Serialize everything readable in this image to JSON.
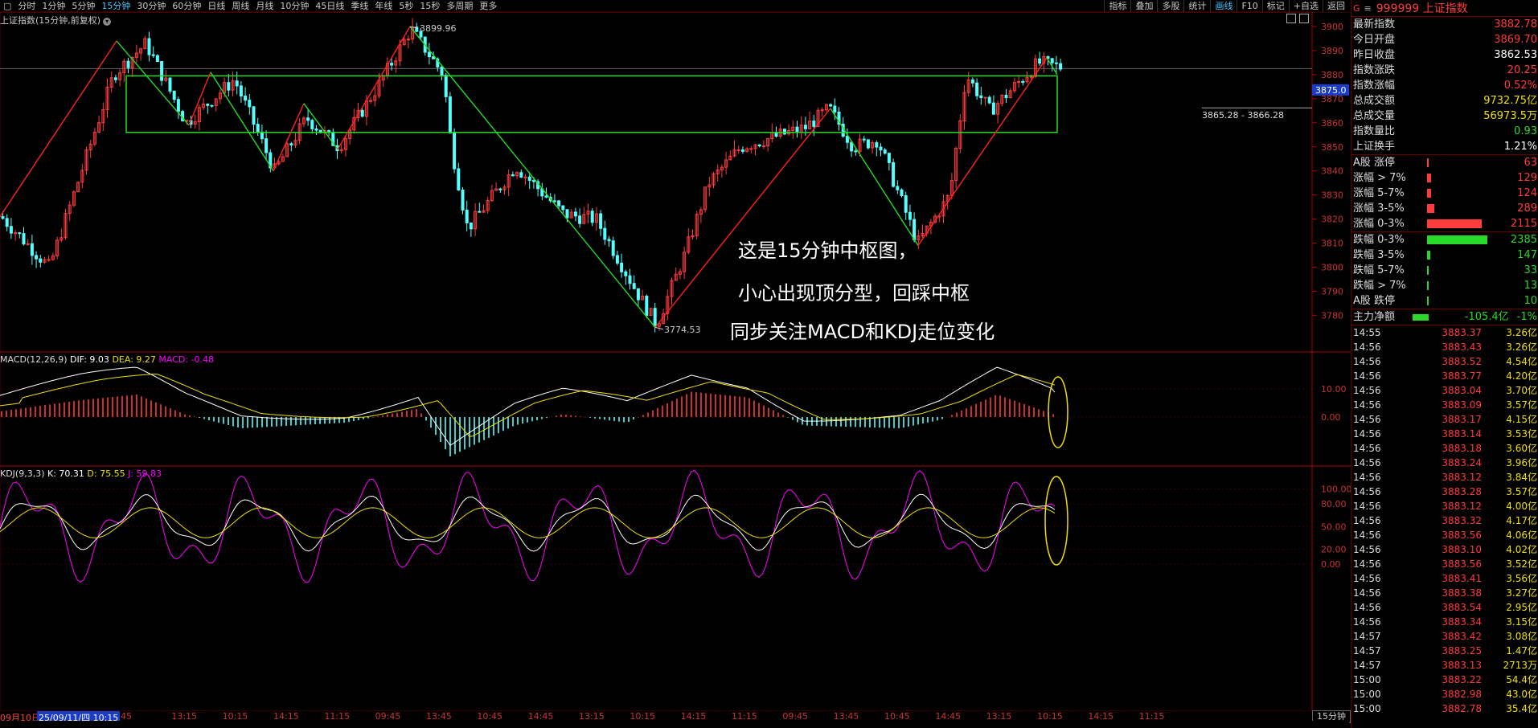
{
  "toolbar": {
    "periods": [
      "分时",
      "1分钟",
      "5分钟",
      "15分钟",
      "30分钟",
      "60分钟",
      "日线",
      "周线",
      "月线",
      "10分钟",
      "45日线",
      "季线",
      "年线",
      "5秒",
      "15秒",
      "多周期",
      "更多"
    ],
    "active_period": "15分钟",
    "right_tools": [
      "指标",
      "叠加",
      "多股",
      "统计",
      "画线",
      "F10",
      "标记",
      "+自选",
      "返回"
    ]
  },
  "chart": {
    "title": "上证指数(15分钟,前复权)",
    "price_axis": [
      "3900",
      "3890",
      "3880",
      "3870",
      "3860",
      "3850",
      "3840",
      "3830",
      "3820",
      "3810",
      "3800",
      "3790",
      "3780"
    ],
    "current_price_tag": "3875.0",
    "high_label": "3899.96",
    "low_label": "3774.53",
    "zone_label": "3865.28 - 3866.28",
    "annotations": [
      "这是15分钟中枢图，",
      "小心出现顶分型，回踩中枢",
      "同步关注MACD和KDJ走位变化"
    ]
  },
  "macd": {
    "legend_name": "MACD(12,26,9)",
    "dif": "DIF: 9.03",
    "dea": "DEA: 9.27",
    "macd": "MACD: -0.48",
    "axis": [
      "10.00",
      "0.00"
    ]
  },
  "kdj": {
    "legend_name": "KDJ(9,3,3)",
    "k": "K: 70.31",
    "d": "D: 75.55",
    "j": "J: 59.83",
    "axis": [
      "100.00",
      "80.00",
      "50.00",
      "20.00",
      "0.00"
    ]
  },
  "time_axis": {
    "start_date": "09月10日",
    "cursor_date": "25/09/11/四 10:15",
    "labels": [
      "45",
      "13:15",
      "10:15",
      "14:15",
      "11:15",
      "09:45",
      "13:45",
      "10:45",
      "14:45",
      "13:15",
      "10:15",
      "14:15",
      "11:15",
      "09:45",
      "13:45",
      "10:45",
      "14:45",
      "13:15",
      "10:15",
      "14:15",
      "11:15"
    ],
    "period_label": "15分钟"
  },
  "quote_panel": {
    "code": "999999",
    "name": "上证指数",
    "g_label": "G",
    "menu": "≡",
    "rows": [
      {
        "k": "最新指数",
        "v": "3882.78",
        "c": "red"
      },
      {
        "k": "今日开盘",
        "v": "3869.70",
        "c": "red"
      },
      {
        "k": "昨日收盘",
        "v": "3862.53",
        "c": "white"
      },
      {
        "k": "指数涨跌",
        "v": "20.25",
        "c": "red"
      },
      {
        "k": "指数涨幅",
        "v": "0.52%",
        "c": "red"
      },
      {
        "k": "总成交额",
        "v": "9732.75亿",
        "c": "yellow"
      },
      {
        "k": "总成交量",
        "v": "56973.5万",
        "c": "yellow"
      },
      {
        "k": "指数量比",
        "v": "0.93",
        "c": "green"
      },
      {
        "k": "上证换手",
        "v": "1.21%",
        "c": "white"
      }
    ],
    "up_dist": [
      {
        "k": "A股 涨停",
        "v": "63",
        "frac": 0.03
      },
      {
        "k": "涨幅 > 7%",
        "v": "129",
        "frac": 0.06
      },
      {
        "k": "涨幅 5-7%",
        "v": "124",
        "frac": 0.06
      },
      {
        "k": "涨幅 3-5%",
        "v": "289",
        "frac": 0.12
      },
      {
        "k": "涨幅 0-3%",
        "v": "2115",
        "frac": 0.9
      }
    ],
    "down_dist": [
      {
        "k": "跌幅 0-3%",
        "v": "2385",
        "frac": 1.0
      },
      {
        "k": "跌幅 3-5%",
        "v": "147",
        "frac": 0.05
      },
      {
        "k": "跌幅 5-7%",
        "v": "33",
        "frac": 0.01
      },
      {
        "k": "跌幅 > 7%",
        "v": "13",
        "frac": 0.01
      },
      {
        "k": "A股 跌停",
        "v": "10",
        "frac": 0.01
      }
    ],
    "net_flow": {
      "k": "主力净额",
      "v": "-105.4亿",
      "pct": "-1%"
    },
    "ticks": [
      {
        "t": "14:55",
        "p": "3883.37",
        "a": "3.26亿"
      },
      {
        "t": "14:56",
        "p": "3883.43",
        "a": "3.26亿"
      },
      {
        "t": "14:56",
        "p": "3883.52",
        "a": "4.54亿"
      },
      {
        "t": "14:56",
        "p": "3883.77",
        "a": "4.20亿"
      },
      {
        "t": "14:56",
        "p": "3883.04",
        "a": "3.70亿"
      },
      {
        "t": "14:56",
        "p": "3883.09",
        "a": "3.57亿"
      },
      {
        "t": "14:56",
        "p": "3883.17",
        "a": "4.15亿"
      },
      {
        "t": "14:56",
        "p": "3883.14",
        "a": "3.53亿"
      },
      {
        "t": "14:56",
        "p": "3883.18",
        "a": "3.60亿"
      },
      {
        "t": "14:56",
        "p": "3883.24",
        "a": "3.96亿"
      },
      {
        "t": "14:56",
        "p": "3883.12",
        "a": "3.84亿"
      },
      {
        "t": "14:56",
        "p": "3883.28",
        "a": "3.57亿"
      },
      {
        "t": "14:56",
        "p": "3883.12",
        "a": "4.00亿"
      },
      {
        "t": "14:56",
        "p": "3883.32",
        "a": "4.17亿"
      },
      {
        "t": "14:56",
        "p": "3883.56",
        "a": "4.06亿"
      },
      {
        "t": "14:56",
        "p": "3883.10",
        "a": "4.02亿"
      },
      {
        "t": "14:56",
        "p": "3883.56",
        "a": "3.52亿"
      },
      {
        "t": "14:56",
        "p": "3883.41",
        "a": "3.56亿"
      },
      {
        "t": "14:56",
        "p": "3883.38",
        "a": "3.27亿"
      },
      {
        "t": "14:56",
        "p": "3883.54",
        "a": "2.95亿"
      },
      {
        "t": "14:56",
        "p": "3883.34",
        "a": "3.15亿"
      },
      {
        "t": "14:57",
        "p": "3883.42",
        "a": "3.08亿"
      },
      {
        "t": "14:57",
        "p": "3883.25",
        "a": "1.47亿"
      },
      {
        "t": "14:57",
        "p": "3883.13",
        "a": "2713万"
      },
      {
        "t": "15:00",
        "p": "3883.22",
        "a": "54.4亿"
      },
      {
        "t": "15:00",
        "p": "3882.98",
        "a": "43.0亿"
      },
      {
        "t": "15:00",
        "p": "3882.78",
        "a": "35.4亿"
      }
    ]
  },
  "colors": {
    "up": "#ff3b3b",
    "down": "#54ffff",
    "zone": "#22dd22",
    "grid": "#5a0000",
    "dif": "#ffffff",
    "dea": "#f0e000",
    "kdj_j": "#ff00ff"
  }
}
